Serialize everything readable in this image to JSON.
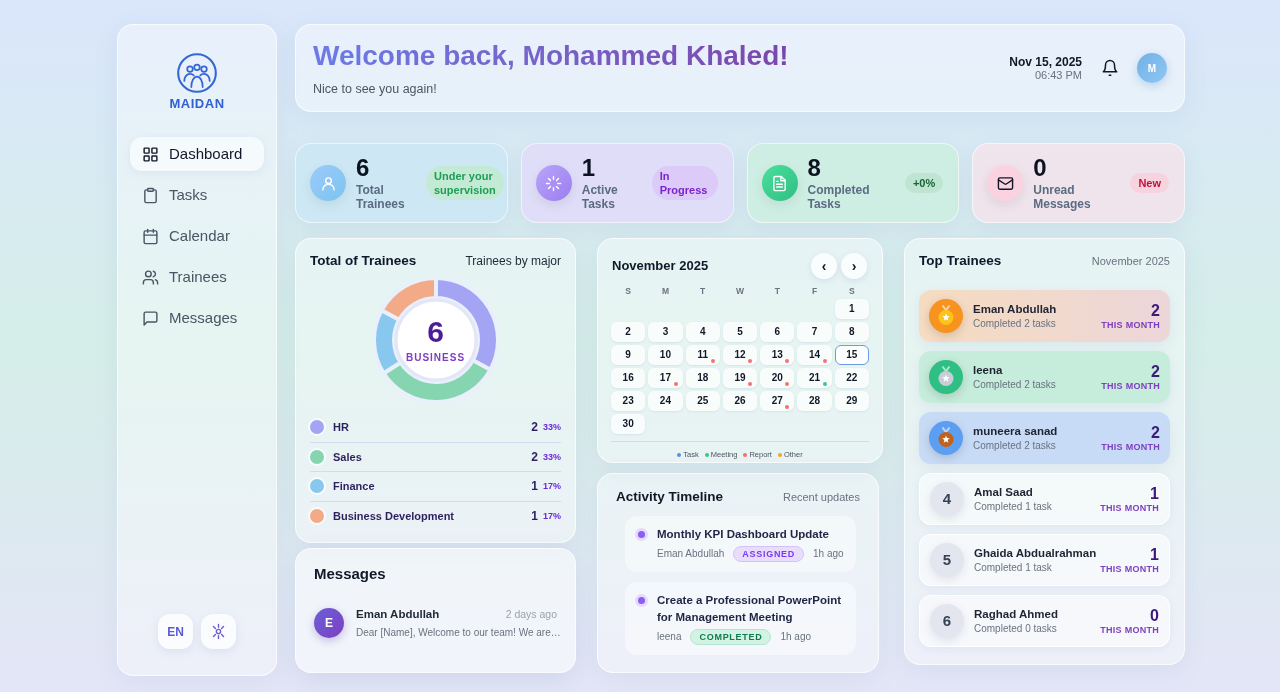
{
  "sidebar": {
    "brand": "MAIDAN",
    "nav": [
      {
        "kind": "dashboard",
        "label": "Dashboard",
        "selected": true
      },
      {
        "kind": "tasks",
        "label": "Tasks",
        "selected": false
      },
      {
        "kind": "calendar",
        "label": "Calendar",
        "selected": false
      },
      {
        "kind": "trainees",
        "label": "Trainees",
        "selected": false
      },
      {
        "kind": "messages",
        "label": "Messages",
        "selected": false
      }
    ],
    "language": "EN"
  },
  "header": {
    "title": "Welcome back, Mohammed Khaled!",
    "subtitle": "Nice to see you again!",
    "date": "Nov 15, 2025",
    "time": "06:43 PM",
    "avatar": "M"
  },
  "stats": [
    {
      "kind": "trainees",
      "value": "6",
      "label": "Total Trainees",
      "badge": "Under your supervision"
    },
    {
      "kind": "active",
      "value": "1",
      "label": "Active Tasks",
      "badge": "In Progress"
    },
    {
      "kind": "completed",
      "value": "8",
      "label": "Completed Tasks",
      "badge": "+0%"
    },
    {
      "kind": "messages",
      "value": "0",
      "label": "Unread Messages",
      "badge": "New"
    }
  ],
  "trainees_by_major": {
    "title": "Total of Trainees",
    "subtitle": "Trainees by major",
    "center_value": "6",
    "center_label": "BUSINESS",
    "chart_data": {
      "type": "donut",
      "categories": [
        "HR",
        "Sales",
        "Finance",
        "Business Development"
      ],
      "values": [
        33,
        33,
        17,
        17
      ]
    },
    "majors": [
      {
        "count": "2",
        "percent": "33%",
        "color": "#a3a5f4"
      },
      {
        "count": "2",
        "percent": "33%",
        "color": "#86d5b1"
      },
      {
        "count": "1",
        "percent": "17%",
        "color": "#88c8ee"
      },
      {
        "count": "1",
        "percent": "17%",
        "color": "#f2ab86"
      }
    ]
  },
  "messages": {
    "title": "Messages",
    "items": [
      {
        "avatar": "E",
        "sender": "Eman Abdullah",
        "time": "2 days ago",
        "preview": "Dear [Name], Welcome to our team! We are…"
      }
    ]
  },
  "calendar": {
    "title": "November 2025",
    "prev": "‹",
    "next": "›",
    "weekdays": [
      "S",
      "M",
      "T",
      "W",
      "T",
      "F",
      "S"
    ],
    "weeks": [
      [
        {
          "day": "1",
          "selected": false
        }
      ],
      [
        {
          "day": "2",
          "selected": false
        },
        {
          "day": "3",
          "selected": false
        },
        {
          "day": "4",
          "selected": false
        },
        {
          "day": "5",
          "selected": false
        },
        {
          "day": "6",
          "selected": false
        },
        {
          "day": "7",
          "selected": false
        },
        {
          "day": "8",
          "selected": false
        }
      ],
      [
        {
          "day": "9",
          "selected": false
        },
        {
          "day": "10",
          "selected": false
        },
        {
          "day": "11",
          "selected": false,
          "color": "#f87171"
        },
        {
          "day": "12",
          "selected": false,
          "color": "#f87171"
        },
        {
          "day": "13",
          "selected": false,
          "color": "#f87171"
        },
        {
          "day": "14",
          "selected": false,
          "color": "#f87171"
        },
        {
          "day": "15",
          "selected": true
        }
      ],
      [
        {
          "day": "16",
          "selected": false
        },
        {
          "day": "17",
          "selected": false,
          "color": "#f87171"
        },
        {
          "day": "18",
          "selected": false
        },
        {
          "day": "19",
          "selected": false,
          "color": "#f87171"
        },
        {
          "day": "20",
          "selected": false,
          "color": "#f87171"
        },
        {
          "day": "21",
          "selected": false,
          "color": "#34c98e"
        },
        {
          "day": "22",
          "selected": false
        }
      ],
      [
        {
          "day": "23",
          "selected": false
        },
        {
          "day": "24",
          "selected": false
        },
        {
          "day": "25",
          "selected": false
        },
        {
          "day": "26",
          "selected": false
        },
        {
          "day": "27",
          "selected": false,
          "color": "#f87171"
        },
        {
          "day": "28",
          "selected": false
        },
        {
          "day": "29",
          "selected": false
        }
      ],
      [
        {
          "day": "30",
          "selected": false
        }
      ]
    ],
    "legend": [
      {
        "label": "Task",
        "color": "#5b8def"
      },
      {
        "label": "Meeting",
        "color": "#34c98e"
      },
      {
        "label": "Report",
        "color": "#f87171"
      },
      {
        "label": "Other",
        "color": "#f5a524"
      }
    ]
  },
  "activity": {
    "title": "Activity Timeline",
    "subtitle": "Recent updates",
    "items": [
      {
        "kind": "assigned",
        "title": "Monthly KPI Dashboard Update",
        "person": "Eman Abdullah",
        "status": "ASSIGNED",
        "time": "1h ago"
      },
      {
        "kind": "completed",
        "title": "Create a Professional PowerPoint for Management Meeting",
        "person": "leena",
        "status": "COMPLETED",
        "time": "1h ago"
      }
    ]
  },
  "top_trainees": {
    "title": "Top Trainees",
    "period": "November 2025",
    "rows": [
      {
        "kind": "gold",
        "name": "Eman Abdullah",
        "detail": "Completed 2 tasks",
        "count": "2",
        "period": "THIS MONTH"
      },
      {
        "kind": "silver",
        "name": "leena",
        "detail": "Completed 2 tasks",
        "count": "2",
        "period": "THIS MONTH"
      },
      {
        "kind": "bronze",
        "name": "muneera sanad",
        "detail": "Completed 2 tasks",
        "count": "2",
        "period": "THIS MONTH"
      },
      {
        "kind": "rank",
        "rank": "4",
        "name": "Amal Saad",
        "detail": "Completed 1 task",
        "count": "1",
        "period": "THIS MONTH"
      },
      {
        "kind": "rank",
        "rank": "5",
        "name": "Ghaida Abdualrahman",
        "detail": "Completed 1 task",
        "count": "1",
        "period": "THIS MONTH"
      },
      {
        "kind": "rank",
        "rank": "6",
        "name": "Raghad Ahmed",
        "detail": "Completed 0 tasks",
        "count": "0",
        "period": "THIS MONTH"
      }
    ]
  }
}
